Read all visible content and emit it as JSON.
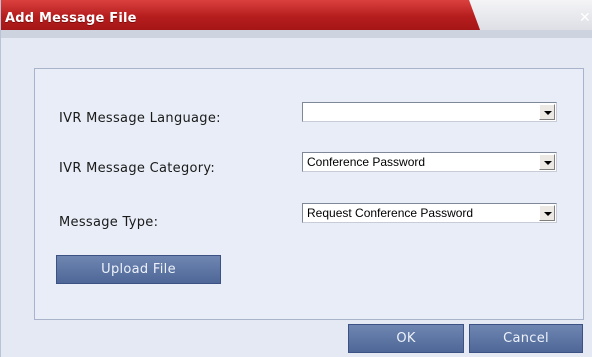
{
  "dialog": {
    "title": "Add Message File",
    "close_glyph": "✕"
  },
  "form": {
    "language_label": "IVR Message Language:",
    "language_value": "",
    "category_label": "IVR Message Category:",
    "category_value": "Conference Password",
    "type_label": "Message Type:",
    "type_value": "Request Conference Password",
    "upload_label": "Upload File"
  },
  "footer": {
    "ok_label": "OK",
    "cancel_label": "Cancel"
  },
  "colors": {
    "title_bar": "#b51d1d",
    "button": "#5b73a3",
    "background": "#e4e9f4"
  }
}
